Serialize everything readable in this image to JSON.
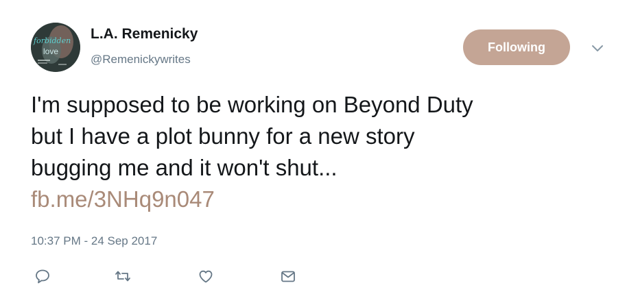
{
  "user": {
    "name": "L.A. Remenicky",
    "handle": "@Remenickywrites",
    "avatar_icon": "book-cover-avatar",
    "avatar_text": [
      "forbidden",
      "love"
    ]
  },
  "follow_button": {
    "label": "Following",
    "color": "#c4a595"
  },
  "tweet": {
    "lines": [
      "I'm supposed to be working on Beyond Duty",
      "but I have a plot bunny for a new story",
      "bugging me and it won't shut..."
    ],
    "link": "fb.me/3NHq9n047",
    "link_color": "#a98a78",
    "timestamp": "10:37 PM - 24 Sep 2017"
  },
  "actions": [
    {
      "name": "reply",
      "icon": "speech-bubble-icon"
    },
    {
      "name": "retweet",
      "icon": "retweet-arrows-icon"
    },
    {
      "name": "like",
      "icon": "heart-icon"
    },
    {
      "name": "direct-message",
      "icon": "envelope-icon"
    }
  ]
}
